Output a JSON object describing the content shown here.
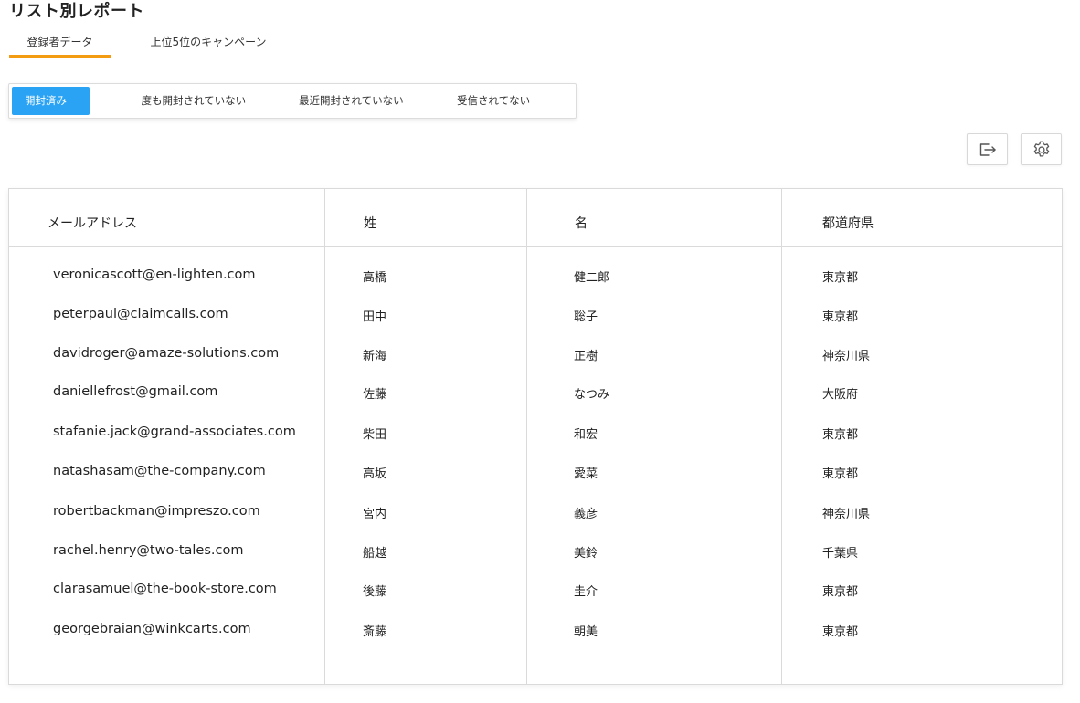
{
  "page": {
    "title": "リスト別レポート"
  },
  "tabs": [
    {
      "label": "登録者データ",
      "active": true
    },
    {
      "label": "上位5位のキャンペーン",
      "active": false
    }
  ],
  "filters": [
    {
      "label": "開封済み",
      "active": true
    },
    {
      "label": "一度も開封されていない",
      "active": false
    },
    {
      "label": "最近開封されていない",
      "active": false
    },
    {
      "label": "受信されてない",
      "active": false
    }
  ],
  "toolbar": {
    "export_icon": "export-icon",
    "settings_icon": "gear-icon"
  },
  "colors": {
    "accent": "#2aa3f5",
    "tab_underline": "#f39c12"
  },
  "table": {
    "headers": [
      "メールアドレス",
      "姓",
      "名",
      "都道府県"
    ],
    "rows": [
      [
        "veronicascott@en-lighten.com",
        "高橋",
        "健二郎",
        "東京都"
      ],
      [
        "peterpaul@claimcalls.com",
        "田中",
        "聡子",
        "東京都"
      ],
      [
        "davidroger@amaze-solutions.com",
        "新海",
        "正樹",
        "神奈川県"
      ],
      [
        "daniellefrost@gmail.com",
        "佐藤",
        "なつみ",
        "大阪府"
      ],
      [
        "stafanie.jack@grand-associates.com",
        "柴田",
        "和宏",
        "東京都"
      ],
      [
        "natashasam@the-company.com",
        "高坂",
        "愛菜",
        "東京都"
      ],
      [
        "robertbackman@impreszo.com",
        "宮内",
        "義彦",
        "神奈川県"
      ],
      [
        "rachel.henry@two-tales.com",
        "船越",
        "美鈴",
        "千葉県"
      ],
      [
        "clarasamuel@the-book-store.com",
        "後藤",
        "圭介",
        "東京都"
      ],
      [
        "georgebraian@winkcarts.com",
        "斎藤",
        "朝美",
        "東京都"
      ]
    ]
  }
}
